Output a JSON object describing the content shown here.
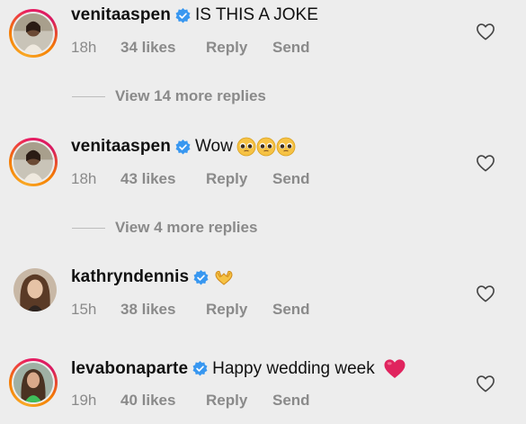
{
  "comments": [
    {
      "username": "venitaaspen",
      "text": "IS THIS A JOKE",
      "emoji": "",
      "time": "18h",
      "likes": "34 likes",
      "reply": "Reply",
      "send": "Send",
      "view_more": "View 14 more replies"
    },
    {
      "username": "venitaaspen",
      "text": "Wow",
      "emoji": "🥺🥺🥺",
      "time": "18h",
      "likes": "43 likes",
      "reply": "Reply",
      "send": "Send",
      "view_more": "View 4 more replies"
    },
    {
      "username": "kathryndennis",
      "text": "",
      "emoji": "🫶",
      "time": "15h",
      "likes": "38 likes",
      "reply": "Reply",
      "send": "Send"
    },
    {
      "username": "levabonaparte",
      "text": "Happy wedding week",
      "emoji": "❤️",
      "time": "19h",
      "likes": "40 likes",
      "reply": "Reply",
      "send": "Send"
    }
  ],
  "icons": {
    "verified": "verified-badge-icon",
    "like": "heart-outline-icon"
  },
  "colors": {
    "verified_blue": "#3897f0",
    "secondary_text": "#8a8a8a",
    "heart_red": "#e0245e"
  }
}
